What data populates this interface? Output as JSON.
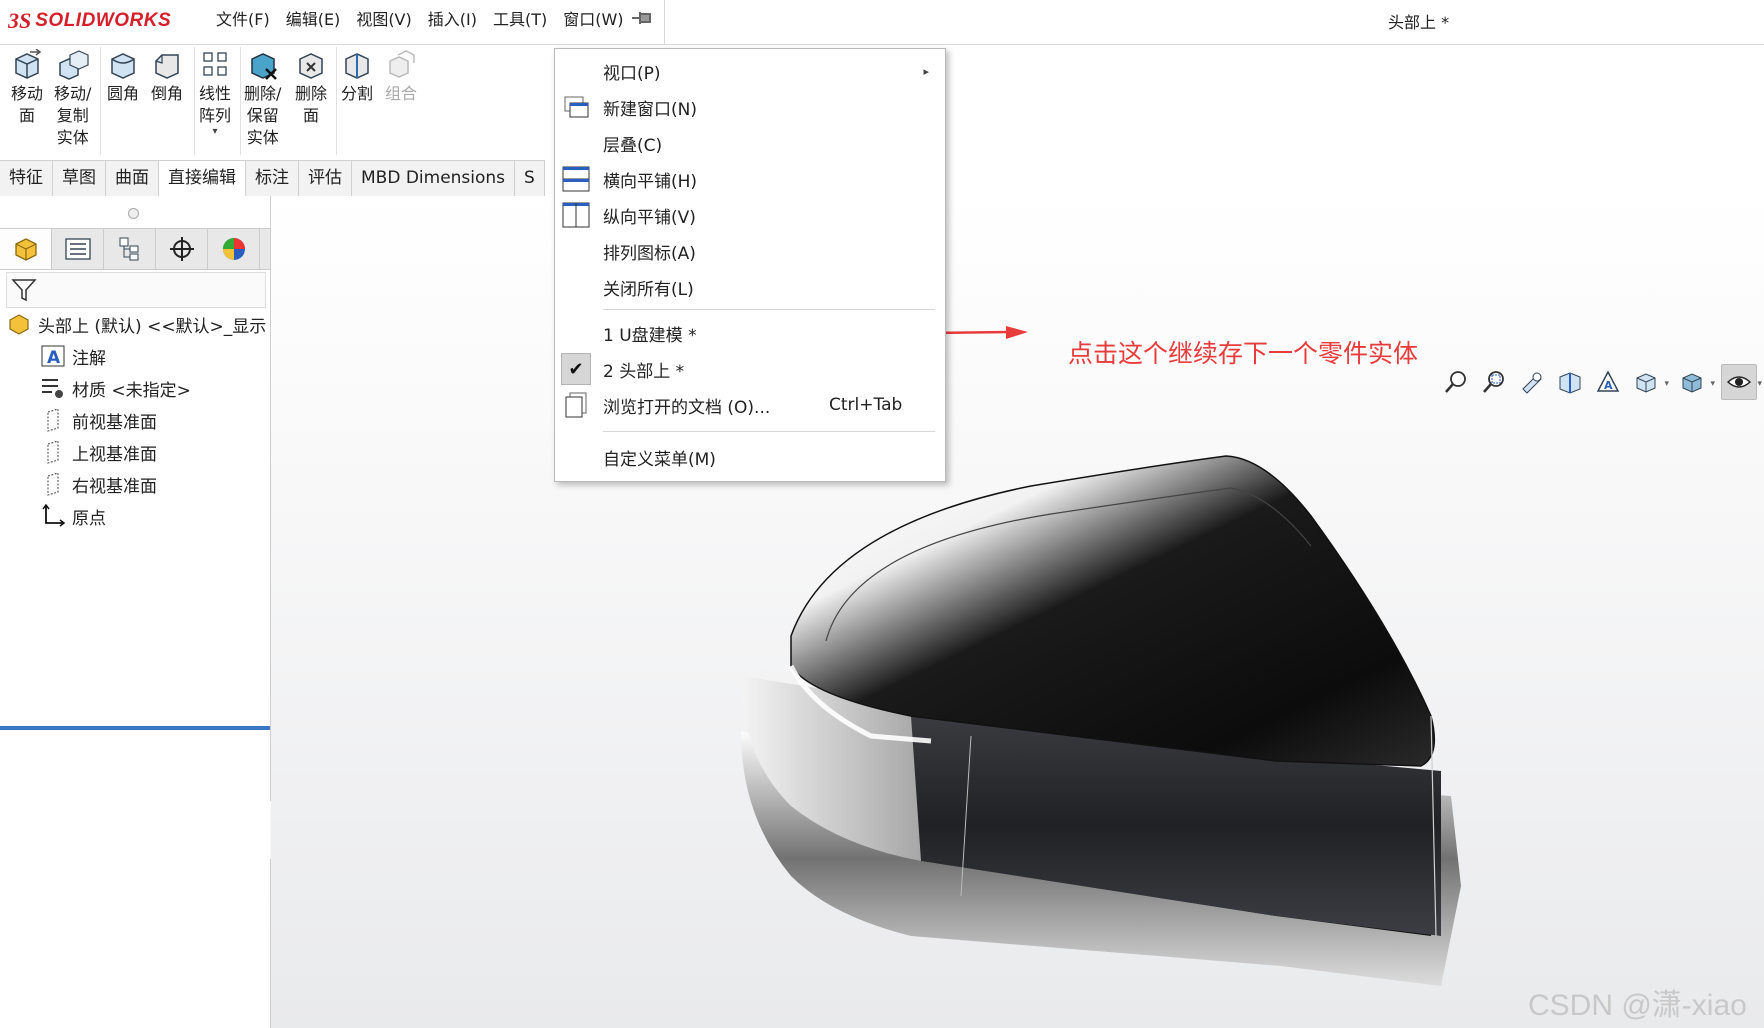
{
  "app": {
    "logo_ds": "3S",
    "logo_name": "SOLIDWORKS",
    "document_title": "头部上 *",
    "brand_color": "#d4202a"
  },
  "menubar": {
    "items": [
      "文件(F)",
      "编辑(E)",
      "视图(V)",
      "插入(I)",
      "工具(T)",
      "窗口(W)"
    ],
    "pin_icon": "pin-icon"
  },
  "ribbon": {
    "buttons": [
      {
        "label": "移动\n面",
        "icon": "move-face-icon",
        "enabled": true
      },
      {
        "label": "移动/\n复制\n实体",
        "icon": "move-copy-body-icon",
        "enabled": true
      },
      {
        "label": "圆角",
        "icon": "fillet-icon",
        "enabled": true
      },
      {
        "label": "倒角",
        "icon": "chamfer-icon",
        "enabled": true
      },
      {
        "label": "线性\n阵列",
        "icon": "linear-pattern-icon",
        "enabled": true
      },
      {
        "label": "删除/\n保留\n实体",
        "icon": "delete-keep-body-icon",
        "enabled": true
      },
      {
        "label": "删除\n面",
        "icon": "delete-face-icon",
        "enabled": true
      },
      {
        "label": "分割",
        "icon": "split-icon",
        "enabled": true
      },
      {
        "label": "组合",
        "icon": "combine-icon",
        "enabled": false
      }
    ]
  },
  "tabs": [
    {
      "label": "特征",
      "active": false
    },
    {
      "label": "草图",
      "active": false
    },
    {
      "label": "曲面",
      "active": false
    },
    {
      "label": "直接编辑",
      "active": true
    },
    {
      "label": "标注",
      "active": false
    },
    {
      "label": "评估",
      "active": false
    },
    {
      "label": "MBD Dimensions",
      "active": false
    },
    {
      "label": "S",
      "active": false
    }
  ],
  "feature_tree": {
    "root": "头部上 (默认) <<默认>_显示",
    "items": [
      {
        "label": "注解",
        "icon": "annotation-icon"
      },
      {
        "label": "材质 <未指定>",
        "icon": "material-icon"
      },
      {
        "label": "前视基准面",
        "icon": "plane-icon"
      },
      {
        "label": "上视基准面",
        "icon": "plane-icon"
      },
      {
        "label": "右视基准面",
        "icon": "plane-icon"
      },
      {
        "label": "原点",
        "icon": "origin-icon"
      }
    ]
  },
  "window_menu": {
    "items": [
      {
        "label": "视口(P)",
        "icon": "",
        "submenu": true
      },
      {
        "label": "新建窗口(N)",
        "icon": "new-window-icon"
      },
      {
        "label": "层叠(C)",
        "icon": ""
      },
      {
        "label": "横向平铺(H)",
        "icon": "tile-horizontal-icon"
      },
      {
        "label": "纵向平铺(V)",
        "icon": "tile-vertical-icon"
      },
      {
        "label": "排列图标(A)",
        "icon": ""
      },
      {
        "label": "关闭所有(L)",
        "icon": ""
      },
      {
        "label": "1 U盘建模 *",
        "icon": ""
      },
      {
        "label": "2 头部上 *",
        "icon": "check-icon",
        "checked": true
      },
      {
        "label": "浏览打开的文档 (O)...",
        "icon": "browse-documents-icon",
        "shortcut": "Ctrl+Tab"
      },
      {
        "label": "自定义菜单(M)",
        "icon": ""
      }
    ]
  },
  "annotation": {
    "text": "点击这个继续存下一个零件实体",
    "color": "#e83c3c"
  },
  "watermark": "CSDN @潇-xiao"
}
